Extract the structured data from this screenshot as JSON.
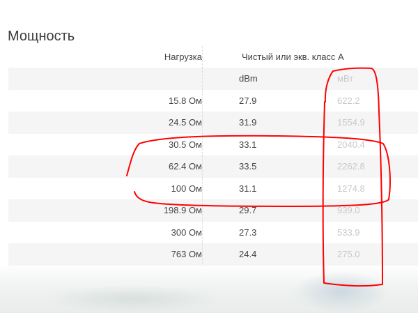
{
  "section": {
    "title": "Мощность"
  },
  "table": {
    "header": {
      "load": "Нагрузка",
      "class": "Чистый или экв. класс A"
    },
    "units": {
      "load": "",
      "dbm": "dBm",
      "mw": "мВт"
    },
    "rows": [
      {
        "load": "15.8 Ом",
        "dbm": "27.9",
        "mw": "622.2"
      },
      {
        "load": "24.5 Ом",
        "dbm": "31.9",
        "mw": "1554.9"
      },
      {
        "load": "30.5 Ом",
        "dbm": "33.1",
        "mw": "2040.4"
      },
      {
        "load": "62.4 Ом",
        "dbm": "33.5",
        "mw": "2262.8"
      },
      {
        "load": "100 Ом",
        "dbm": "31.1",
        "mw": "1274.8"
      },
      {
        "load": "198.9 Ом",
        "dbm": "29.7",
        "mw": "939.0"
      },
      {
        "load": "300 Ом",
        "dbm": "27.3",
        "mw": "533.9"
      },
      {
        "load": "763 Ом",
        "dbm": "24.4",
        "mw": "275.0"
      }
    ]
  },
  "annotations": {
    "color": "#ff0000"
  }
}
